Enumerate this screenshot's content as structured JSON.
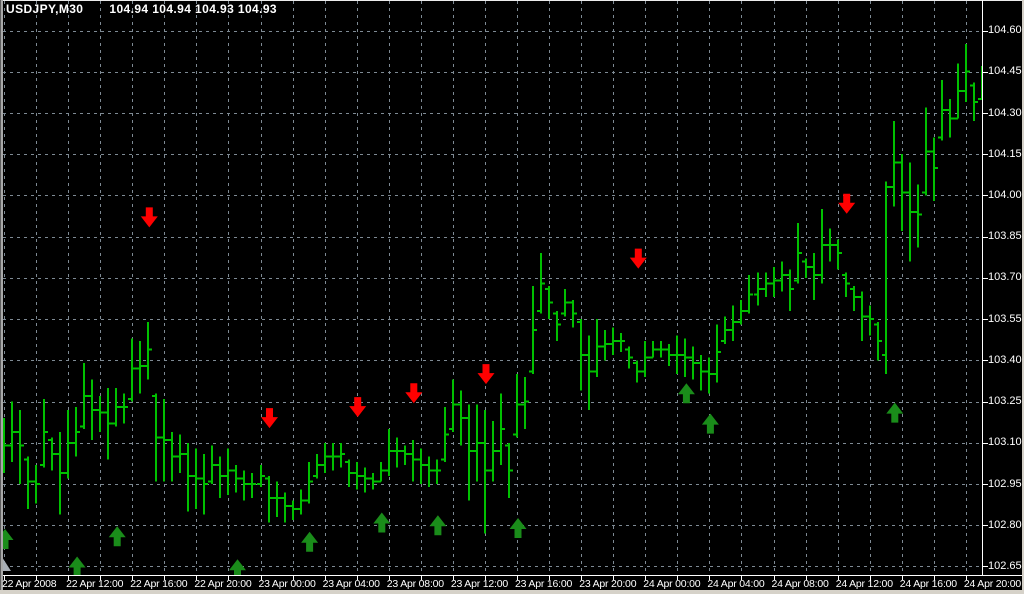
{
  "window": {
    "title_symbol": "USDJPY,M30",
    "title_quotes": "104.94 104.94 104.93 104.93"
  },
  "chart_data": {
    "type": "ohlc-bar",
    "symbol": "USDJPY",
    "timeframe": "M30",
    "current_quote_ohlc": [
      "104.94",
      "104.94",
      "104.93",
      "104.93"
    ],
    "title": "USDJPY,M30  104.94 104.94 104.93 104.93",
    "bar_interval_minutes": 30,
    "first_bar_time": "22 Apr 2008 08:00",
    "x_labels": [
      "22 Apr 2008",
      "22 Apr 12:00",
      "22 Apr 16:00",
      "22 Apr 20:00",
      "23 Apr 00:00",
      "23 Apr 04:00",
      "23 Apr 08:00",
      "23 Apr 12:00",
      "23 Apr 16:00",
      "23 Apr 20:00",
      "24 Apr 00:00",
      "24 Apr 04:00",
      "24 Apr 08:00",
      "24 Apr 12:00",
      "24 Apr 16:00",
      "24 Apr 20:00"
    ],
    "bars_per_x_label": 8,
    "y_ticks": [
      "104.60",
      "104.45",
      "104.30",
      "104.15",
      "104.00",
      "103.85",
      "103.70",
      "103.55",
      "103.40",
      "103.25",
      "103.10",
      "102.95",
      "102.80",
      "102.65"
    ],
    "y_tick_step": 0.15,
    "ylim": [
      102.62,
      104.66
    ],
    "grid": "dashed",
    "legend_position": "none",
    "bars": [
      [
        103.1,
        103.19,
        102.99,
        103.09
      ],
      [
        103.09,
        103.25,
        103.03,
        103.14
      ],
      [
        103.14,
        103.22,
        102.95,
        103.09
      ],
      [
        103.04,
        103.05,
        102.86,
        102.96
      ],
      [
        102.96,
        103.02,
        102.88,
        102.95
      ],
      [
        103.02,
        103.26,
        103.01,
        103.14
      ],
      [
        103.11,
        103.12,
        103.0,
        103.06
      ],
      [
        103.06,
        103.14,
        102.84,
        102.99
      ],
      [
        102.99,
        103.22,
        102.97,
        103.1
      ],
      [
        103.1,
        103.23,
        103.05,
        103.14
      ],
      [
        103.16,
        103.39,
        103.15,
        103.27
      ],
      [
        103.27,
        103.33,
        103.11,
        103.22
      ],
      [
        103.22,
        103.27,
        103.14,
        103.21
      ],
      [
        103.21,
        103.3,
        103.04,
        103.17
      ],
      [
        103.17,
        103.3,
        103.16,
        103.23
      ],
      [
        103.23,
        103.28,
        103.17,
        103.23
      ],
      [
        103.26,
        103.48,
        103.25,
        103.37
      ],
      [
        103.37,
        103.47,
        103.28,
        103.38
      ],
      [
        103.38,
        103.54,
        103.33,
        103.44
      ],
      [
        103.27,
        103.28,
        102.96,
        103.12
      ],
      [
        103.12,
        103.26,
        102.96,
        103.11
      ],
      [
        103.11,
        103.14,
        102.96,
        103.05
      ],
      [
        103.05,
        103.13,
        102.99,
        103.06
      ],
      [
        103.06,
        103.1,
        102.85,
        102.98
      ],
      [
        102.98,
        103.08,
        102.86,
        102.97
      ],
      [
        102.97,
        103.06,
        102.84,
        102.95
      ],
      [
        102.96,
        103.09,
        102.95,
        103.02
      ],
      [
        103.02,
        103.05,
        102.9,
        102.98
      ],
      [
        102.98,
        103.08,
        102.91,
        103.0
      ],
      [
        103.0,
        103.02,
        102.92,
        102.97
      ],
      [
        102.97,
        103.0,
        102.89,
        102.95
      ],
      [
        102.95,
        102.99,
        102.9,
        102.95
      ],
      [
        102.95,
        103.02,
        102.94,
        102.98
      ],
      [
        102.97,
        102.98,
        102.81,
        102.9
      ],
      [
        102.9,
        102.96,
        102.83,
        102.9
      ],
      [
        102.9,
        102.92,
        102.81,
        102.87
      ],
      [
        102.87,
        102.89,
        102.82,
        102.86
      ],
      [
        102.86,
        102.93,
        102.84,
        102.89
      ],
      [
        102.89,
        103.03,
        102.88,
        102.96
      ],
      [
        102.98,
        103.06,
        102.97,
        103.02
      ],
      [
        103.02,
        103.1,
        102.99,
        103.05
      ],
      [
        103.05,
        103.1,
        103.0,
        103.05
      ],
      [
        103.05,
        103.1,
        103.01,
        103.06
      ],
      [
        103.03,
        103.04,
        102.94,
        102.99
      ],
      [
        102.99,
        103.03,
        102.93,
        102.98
      ],
      [
        102.98,
        103.01,
        102.92,
        102.97
      ],
      [
        102.97,
        102.99,
        102.93,
        102.96
      ],
      [
        102.96,
        103.03,
        102.96,
        103.0
      ],
      [
        103.0,
        103.15,
        102.98,
        103.07
      ],
      [
        103.07,
        103.12,
        103.01,
        103.07
      ],
      [
        103.07,
        103.09,
        103.02,
        103.06
      ],
      [
        103.06,
        103.11,
        102.96,
        103.04
      ],
      [
        103.04,
        103.08,
        102.95,
        103.02
      ],
      [
        103.02,
        103.05,
        102.94,
        103.0
      ],
      [
        103.0,
        103.04,
        102.95,
        103.0
      ],
      [
        103.04,
        103.23,
        103.03,
        103.13
      ],
      [
        103.15,
        103.33,
        103.14,
        103.24
      ],
      [
        103.24,
        103.29,
        103.09,
        103.19
      ],
      [
        103.19,
        103.24,
        102.89,
        103.07
      ],
      [
        103.07,
        103.24,
        102.96,
        103.1
      ],
      [
        103.1,
        103.22,
        102.77,
        103.0
      ],
      [
        103.0,
        103.18,
        102.96,
        103.07
      ],
      [
        103.07,
        103.28,
        103.02,
        103.15
      ],
      [
        103.09,
        103.1,
        102.9,
        103.0
      ],
      [
        103.13,
        103.35,
        103.12,
        103.24
      ],
      [
        103.24,
        103.34,
        103.15,
        103.25
      ],
      [
        103.36,
        103.67,
        103.35,
        103.51
      ],
      [
        103.58,
        103.79,
        103.57,
        103.68
      ],
      [
        103.66,
        103.67,
        103.55,
        103.61
      ],
      [
        103.57,
        103.58,
        103.47,
        103.53
      ],
      [
        103.57,
        103.66,
        103.56,
        103.61
      ],
      [
        103.61,
        103.62,
        103.52,
        103.57
      ],
      [
        103.54,
        103.55,
        103.29,
        103.42
      ],
      [
        103.42,
        103.49,
        103.22,
        103.36
      ],
      [
        103.36,
        103.55,
        103.34,
        103.45
      ],
      [
        103.45,
        103.51,
        103.4,
        103.46
      ],
      [
        103.46,
        103.52,
        103.42,
        103.47
      ],
      [
        103.47,
        103.5,
        103.43,
        103.47
      ],
      [
        103.44,
        103.45,
        103.37,
        103.41
      ],
      [
        103.39,
        103.4,
        103.32,
        103.36
      ],
      [
        103.36,
        103.47,
        103.34,
        103.41
      ],
      [
        103.41,
        103.47,
        103.41,
        103.44
      ],
      [
        103.44,
        103.47,
        103.41,
        103.44
      ],
      [
        103.44,
        103.46,
        103.38,
        103.42
      ],
      [
        103.42,
        103.49,
        103.35,
        103.42
      ],
      [
        103.42,
        103.48,
        103.34,
        103.41
      ],
      [
        103.41,
        103.45,
        103.33,
        103.39
      ],
      [
        103.39,
        103.42,
        103.29,
        103.36
      ],
      [
        103.36,
        103.41,
        103.28,
        103.35
      ],
      [
        103.35,
        103.53,
        103.32,
        103.43
      ],
      [
        103.47,
        103.56,
        103.46,
        103.51
      ],
      [
        103.51,
        103.6,
        103.47,
        103.54
      ],
      [
        103.54,
        103.62,
        103.53,
        103.58
      ],
      [
        103.58,
        103.71,
        103.57,
        103.64
      ],
      [
        103.64,
        103.72,
        103.6,
        103.66
      ],
      [
        103.66,
        103.72,
        103.63,
        103.68
      ],
      [
        103.68,
        103.74,
        103.63,
        103.69
      ],
      [
        103.69,
        103.76,
        103.65,
        103.71
      ],
      [
        103.71,
        103.73,
        103.58,
        103.66
      ],
      [
        103.69,
        103.9,
        103.68,
        103.79
      ],
      [
        103.76,
        103.77,
        103.7,
        103.74
      ],
      [
        103.74,
        103.79,
        103.62,
        103.71
      ],
      [
        103.71,
        103.95,
        103.68,
        103.82
      ],
      [
        103.82,
        103.88,
        103.76,
        103.82
      ],
      [
        103.82,
        103.84,
        103.73,
        103.79
      ],
      [
        103.71,
        103.72,
        103.63,
        103.68
      ],
      [
        103.66,
        103.67,
        103.58,
        103.63
      ],
      [
        103.63,
        103.65,
        103.47,
        103.56
      ],
      [
        103.56,
        103.6,
        103.49,
        103.55
      ],
      [
        103.53,
        103.54,
        103.4,
        103.47
      ],
      [
        103.42,
        104.05,
        103.35,
        104.03
      ],
      [
        104.03,
        104.27,
        103.96,
        104.12
      ],
      [
        104.12,
        104.15,
        103.87,
        104.01
      ],
      [
        104.01,
        104.12,
        103.76,
        103.94
      ],
      [
        103.94,
        104.04,
        103.81,
        103.93
      ],
      [
        104.01,
        104.32,
        104.0,
        104.16
      ],
      [
        104.16,
        104.21,
        103.98,
        104.1
      ],
      [
        104.21,
        104.42,
        104.2,
        104.31
      ],
      [
        104.31,
        104.35,
        104.21,
        104.28
      ],
      [
        104.28,
        104.48,
        104.28,
        104.38
      ],
      [
        104.38,
        104.55,
        104.34,
        104.45
      ],
      [
        104.4,
        104.41,
        104.27,
        104.34
      ],
      [
        104.35,
        104.47,
        104.35,
        104.41
      ]
    ],
    "signals_down": [
      {
        "bar": 18,
        "price": 103.92
      },
      {
        "bar": 33,
        "price": 103.19
      },
      {
        "bar": 44,
        "price": 103.23
      },
      {
        "bar": 51,
        "price": 103.28
      },
      {
        "bar": 60,
        "price": 103.35
      },
      {
        "bar": 79,
        "price": 103.77
      },
      {
        "bar": 105,
        "price": 103.97
      }
    ],
    "signals_up": [
      {
        "bar": 0,
        "price": 102.75
      },
      {
        "bar": 9,
        "price": 102.65
      },
      {
        "bar": 14,
        "price": 102.76
      },
      {
        "bar": 29,
        "price": 102.64
      },
      {
        "bar": 38,
        "price": 102.74
      },
      {
        "bar": 47,
        "price": 102.81
      },
      {
        "bar": 54,
        "price": 102.8
      },
      {
        "bar": 64,
        "price": 102.79
      },
      {
        "bar": 85,
        "price": 103.28
      },
      {
        "bar": 88,
        "price": 103.17
      },
      {
        "bar": 111,
        "price": 103.21
      }
    ],
    "colors": {
      "background": "#000000",
      "grid": "#7e8a94",
      "bar": "#00c000",
      "up_arrow": "#1a8c1a",
      "down_arrow": "#ff0000",
      "text": "#ffffff",
      "axis_line": "#ffffff",
      "frame": "#d4d0c8"
    }
  }
}
